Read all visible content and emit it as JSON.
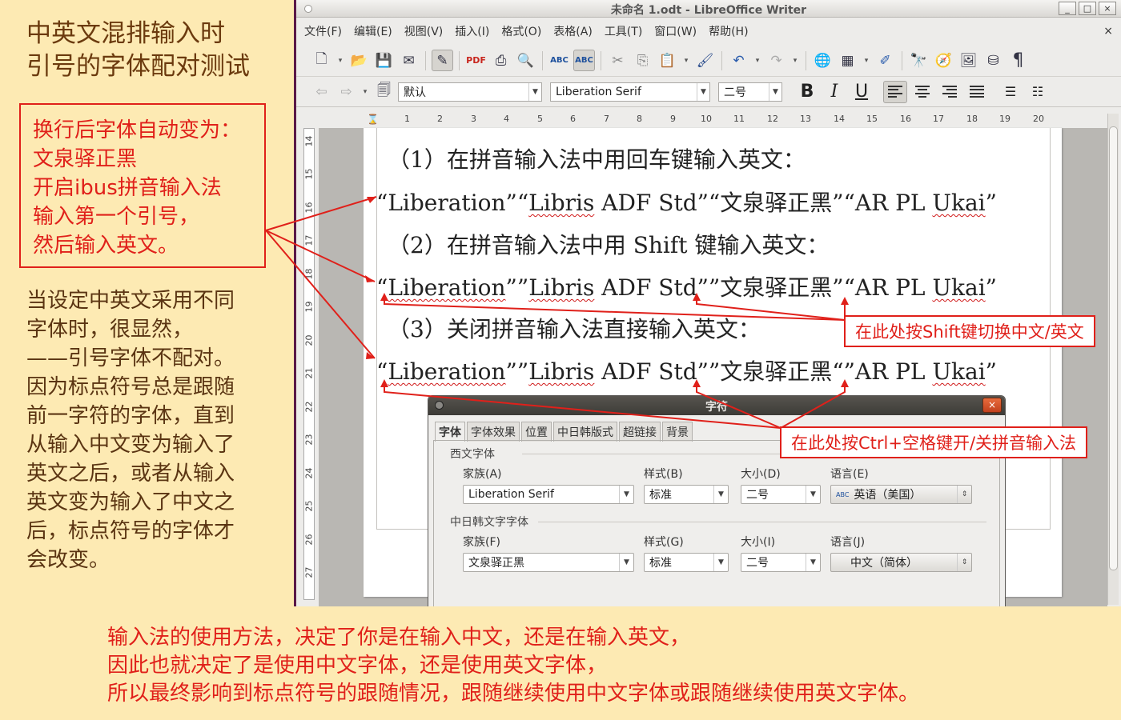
{
  "annotation": {
    "title_lines": [
      "中英文混排输入时",
      "引号的字体配对测试"
    ],
    "box_lines": [
      "换行后字体自动变为：",
      "文泉驿正黑",
      "开启ibus拼音输入法",
      "输入第一个引号，",
      "然后输入英文。"
    ],
    "explain_lines": [
      "当设定中英文采用不同",
      "字体时，很显然，",
      "——引号字体不配对。",
      "因为标点符号总是跟随",
      "前一字符的字体，直到",
      "从输入中文变为输入了",
      "英文之后，或者从输入",
      "英文变为输入了中文之",
      "后，标点符号的字体才",
      "会改变。"
    ],
    "bottom_lines": [
      "输入法的使用方法，决定了你是在输入中文，还是在输入英文，",
      "因此也就决定了是使用中文字体，还是使用英文字体，",
      "所以最终影响到标点符号的跟随情况，跟随继续使用中文字体或跟随继续使用英文字体。"
    ],
    "callout_shift": "在此处按Shift键切换中文/英文",
    "callout_ctrl": "在此处按Ctrl+空格键开/关拼音输入法"
  },
  "window": {
    "title": "未命名 1.odt - LibreOffice Writer",
    "buttons": [
      "_",
      "□",
      "×"
    ],
    "menu": [
      "文件(F)",
      "编辑(E)",
      "视图(V)",
      "插入(I)",
      "格式(O)",
      "表格(A)",
      "工具(T)",
      "窗口(W)",
      "帮助(H)"
    ],
    "menu_close": "×"
  },
  "formatting": {
    "style": "默认",
    "font": "Liberation Serif",
    "size": "二号"
  },
  "ruler": {
    "top": [
      "1",
      "2",
      "3",
      "4",
      "5",
      "6",
      "7",
      "8",
      "9",
      "10",
      "11",
      "12",
      "13",
      "14",
      "15",
      "16",
      "17",
      "18",
      "19",
      "20"
    ],
    "left": [
      "14",
      "15",
      "16",
      "17",
      "18",
      "19",
      "20",
      "21",
      "22",
      "23",
      "24",
      "25",
      "26",
      "27"
    ]
  },
  "document": {
    "h1": "（1）在拼音输入法中用回车键输入英文：",
    "l1": [
      "“Liberation”“",
      "Libris",
      " ADF Std”“文泉驿正黑”“AR PL ",
      "Ukai",
      "”"
    ],
    "h2": "（2）在拼音输入法中用 Shift 键输入英文：",
    "l2": [
      "“",
      "Liberation",
      "””",
      "Libris",
      " ADF Std””文泉驿正黑”“AR PL ",
      "Ukai",
      "”"
    ],
    "h3": "（3）关闭拼音输入法直接输入英文：",
    "l3": [
      "“",
      "Liberation",
      "””",
      "Libris",
      " ADF Std””文泉驿正黑“”AR PL ",
      "Ukai",
      "”"
    ]
  },
  "dialog": {
    "title": "字符",
    "close": "×",
    "tabs": [
      "字体",
      "字体效果",
      "位置",
      "中日韩版式",
      "超链接",
      "背景"
    ],
    "western_group": "西文字体",
    "cjk_group": "中日韩文字字体",
    "labels": {
      "family": "家族(A)",
      "style": "样式(B)",
      "size": "大小(D)",
      "lang": "语言(E)",
      "family2": "家族(F)",
      "style2": "样式(G)",
      "size2": "大小(I)",
      "lang2": "语言(J)"
    },
    "western": {
      "family": "Liberation Serif",
      "style": "标准",
      "size": "二号",
      "lang": "英语（美国）"
    },
    "cjk": {
      "family": "文泉驿正黑",
      "style": "标准",
      "size": "二号",
      "lang": "中文（简体）"
    }
  },
  "colors": {
    "accent_red": "#e0201a",
    "background": "#fdeab3"
  }
}
